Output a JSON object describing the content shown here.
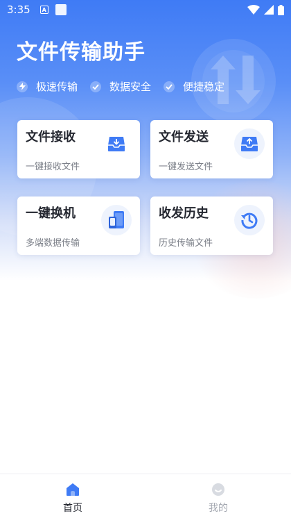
{
  "status_bar": {
    "time": "3:35",
    "a_badge": "A"
  },
  "app": {
    "title": "文件传输助手"
  },
  "features": [
    {
      "label": "极速传输",
      "icon": "bolt-icon"
    },
    {
      "label": "数据安全",
      "icon": "check-icon"
    },
    {
      "label": "便捷稳定",
      "icon": "check-icon"
    }
  ],
  "cards": [
    {
      "title": "文件接收",
      "subtitle": "一键接收文件",
      "icon": "inbox-download-icon"
    },
    {
      "title": "文件发送",
      "subtitle": "一键发送文件",
      "icon": "inbox-upload-icon"
    },
    {
      "title": "一键换机",
      "subtitle": "多端数据传输",
      "icon": "phone-transfer-icon"
    },
    {
      "title": "收发历史",
      "subtitle": "历史传输文件",
      "icon": "history-icon"
    }
  ],
  "tabs": [
    {
      "label": "首页",
      "icon": "home-icon",
      "active": true
    },
    {
      "label": "我的",
      "icon": "profile-icon",
      "active": false
    }
  ],
  "colors": {
    "accent": "#3f7bf5",
    "icon_bg": "#eef3fd"
  }
}
